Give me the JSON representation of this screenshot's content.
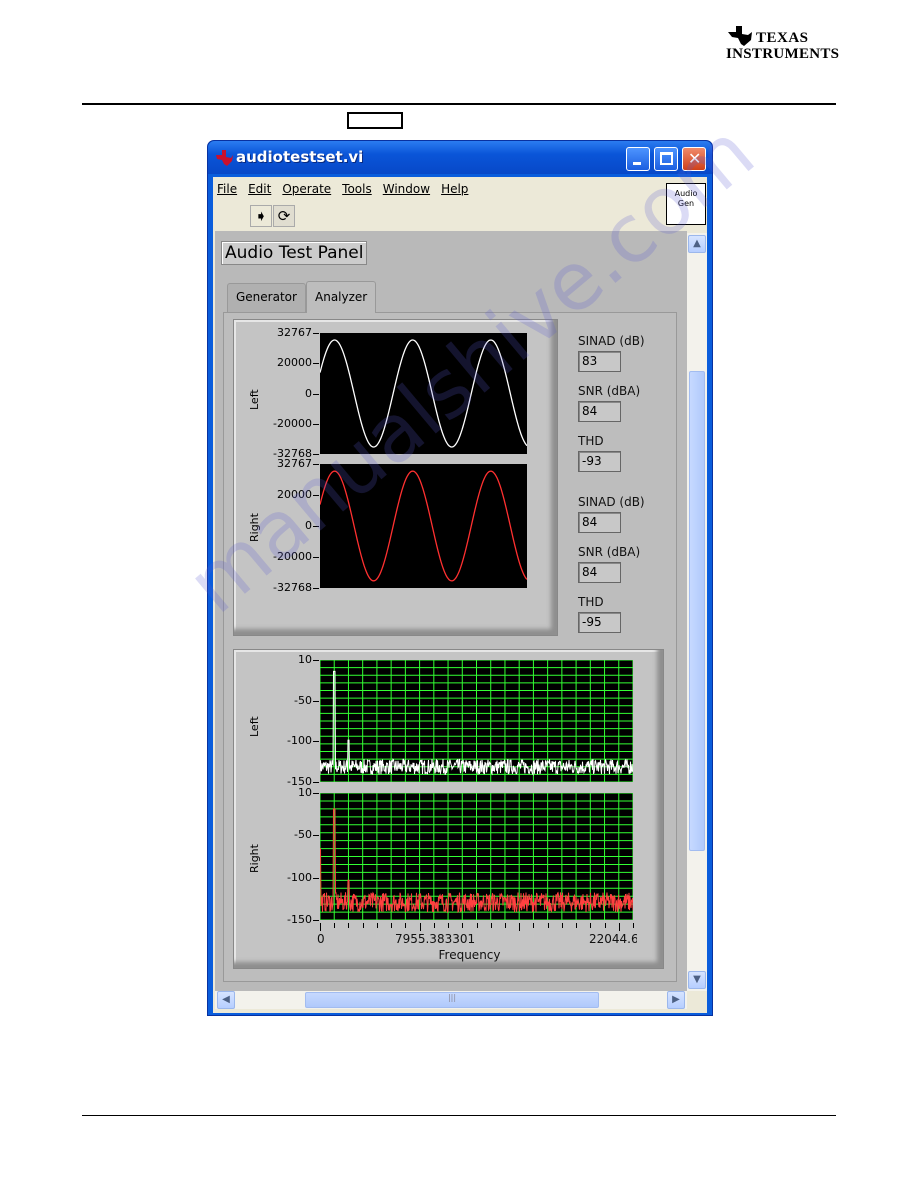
{
  "logo": {
    "line1": "TEXAS",
    "line2": "INSTRUMENTS"
  },
  "window": {
    "title": "audiotestset.vi",
    "menu": [
      "File",
      "Edit",
      "Operate",
      "Tools",
      "Window",
      "Help"
    ],
    "toolbar": {
      "run_icon": "run-arrow-icon",
      "continuous_icon": "run-continuous-icon"
    },
    "audio_gen": {
      "line1": "Audio",
      "line2": "Gen"
    },
    "panel_title": "Audio Test Panel",
    "tabs": [
      {
        "label": "Generator",
        "active": false
      },
      {
        "label": "Analyzer",
        "active": true
      }
    ]
  },
  "measurements": {
    "left": [
      {
        "label": "SINAD (dB)",
        "value": "83"
      },
      {
        "label": "SNR (dBA)",
        "value": "84"
      },
      {
        "label": "THD",
        "value": "-93"
      }
    ],
    "right": [
      {
        "label": "SINAD (dB)",
        "value": "84"
      },
      {
        "label": "SNR (dBA)",
        "value": "84"
      },
      {
        "label": "THD",
        "value": "-95"
      }
    ]
  },
  "chart_data": [
    {
      "type": "line",
      "ylabel": "Left",
      "ylim": [
        -32768,
        32767
      ],
      "yticks": [
        "32767",
        "20000",
        "0",
        "-20000",
        "-32768"
      ],
      "waveform": "sine",
      "amplitude": 29000,
      "cycles": 2.65,
      "color": "#ffffff",
      "background": "#000000",
      "grid": false
    },
    {
      "type": "line",
      "ylabel": "Right",
      "ylim": [
        -32768,
        32767
      ],
      "yticks": [
        "32767",
        "20000",
        "0",
        "-20000",
        "-32768"
      ],
      "waveform": "sine",
      "amplitude": 29000,
      "cycles": 2.65,
      "color": "#ff3030",
      "background": "#000000",
      "grid": false
    },
    {
      "type": "line",
      "ylabel": "Left",
      "ylim": [
        -150,
        10
      ],
      "yticks": [
        "10",
        "-50",
        "-100",
        "-150"
      ],
      "xlim": [
        0,
        22044.6166
      ],
      "noise_floor_db": [
        -140,
        -120
      ],
      "peaks": [
        {
          "x": 1000,
          "y": -5
        },
        {
          "x": 2000,
          "y": -95
        }
      ],
      "color": "#ffffff",
      "grid_color": "#33ff33",
      "grid": true
    },
    {
      "type": "line",
      "ylabel": "Right",
      "xlabel": "Frequency",
      "ylim": [
        -150,
        10
      ],
      "yticks": [
        "10",
        "-50",
        "-100",
        "-150"
      ],
      "xlim": [
        0,
        22044.6166
      ],
      "xticks": [
        "0",
        "7955.383301",
        "22044.6166"
      ],
      "noise_floor_db": [
        -140,
        -115
      ],
      "peaks": [
        {
          "x": 0,
          "y": -60
        },
        {
          "x": 1000,
          "y": -10
        },
        {
          "x": 2000,
          "y": -100
        }
      ],
      "color": "#ff4040",
      "grid_color": "#33ff33",
      "grid": true
    }
  ],
  "watermark": "manualshive.com"
}
